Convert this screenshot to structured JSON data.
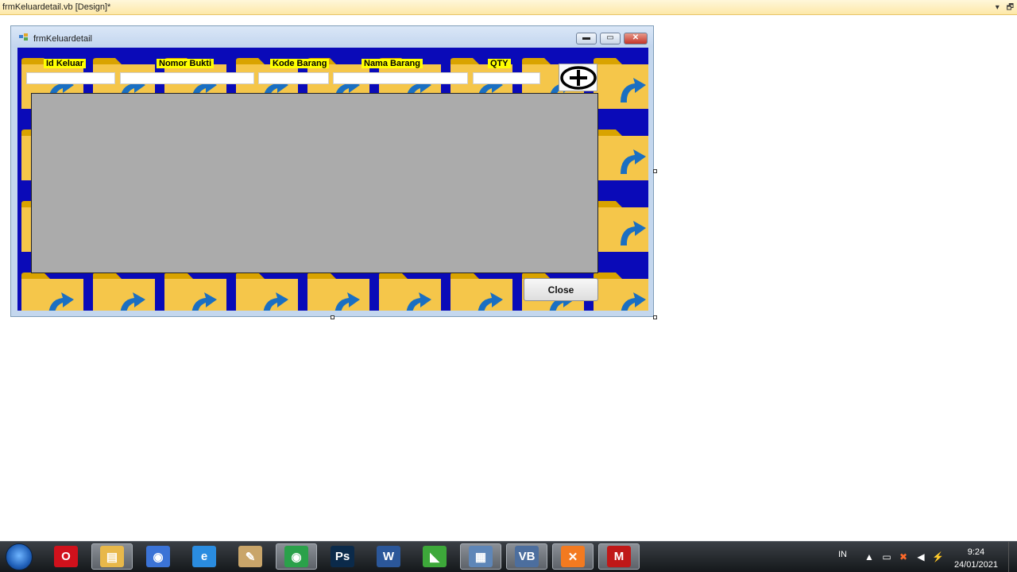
{
  "ide": {
    "document_tab": "frmKeluardetail.vb [Design]*",
    "tab_buttons": [
      "▾",
      "🗗",
      "✕"
    ]
  },
  "form": {
    "title": "frmKeluardetail",
    "window_buttons": {
      "minimize": "▬",
      "maximize": "▭",
      "close": "✕"
    },
    "labels": {
      "id_keluar": "Id Keluar",
      "nomor_bukti": "Nomor Bukti",
      "kode_barang": "Kode Barang",
      "nama_barang": "Nama Barang",
      "qty": "QTY"
    },
    "fields": {
      "id_keluar": "",
      "nomor_bukti": "",
      "kode_barang": "",
      "nama_barang": "",
      "qty": ""
    },
    "add_button_icon": "plus-circle-icon",
    "close_button": "Close",
    "colors": {
      "background": "#0a0ab8",
      "label_highlight": "#ffff00",
      "folder": "#f5c64a",
      "folder_tab": "#d9a300",
      "arrow": "#1a6fc2",
      "grid": "#ababab"
    }
  },
  "taskbar": {
    "apps": [
      {
        "name": "opera-icon",
        "glyph": "O",
        "color": "#d1111c"
      },
      {
        "name": "file-explorer-icon",
        "glyph": "▤",
        "color": "#e8b84a"
      },
      {
        "name": "chromium-icon",
        "glyph": "◉",
        "color": "#3b73d6"
      },
      {
        "name": "internet-explorer-icon",
        "glyph": "e",
        "color": "#2a8ce0"
      },
      {
        "name": "paint-icon",
        "glyph": "✎",
        "color": "#c9a56a"
      },
      {
        "name": "chrome-icon",
        "glyph": "◉",
        "color": "#2aa14a"
      },
      {
        "name": "photoshop-icon",
        "glyph": "Ps",
        "color": "#0b2a4a"
      },
      {
        "name": "word-icon",
        "glyph": "W",
        "color": "#2b579a"
      },
      {
        "name": "coreldraw-icon",
        "glyph": "◣",
        "color": "#3da83a"
      },
      {
        "name": "control-panel-icon",
        "glyph": "▦",
        "color": "#5e86b8"
      },
      {
        "name": "visual-basic-icon",
        "glyph": "VB",
        "color": "#4c6e9e"
      },
      {
        "name": "xampp-icon",
        "glyph": "✕",
        "color": "#f37a20"
      },
      {
        "name": "mcafee-icon",
        "glyph": "M",
        "color": "#c01818"
      }
    ],
    "language": "IN",
    "time": "9:24",
    "date": "24/01/2021"
  }
}
